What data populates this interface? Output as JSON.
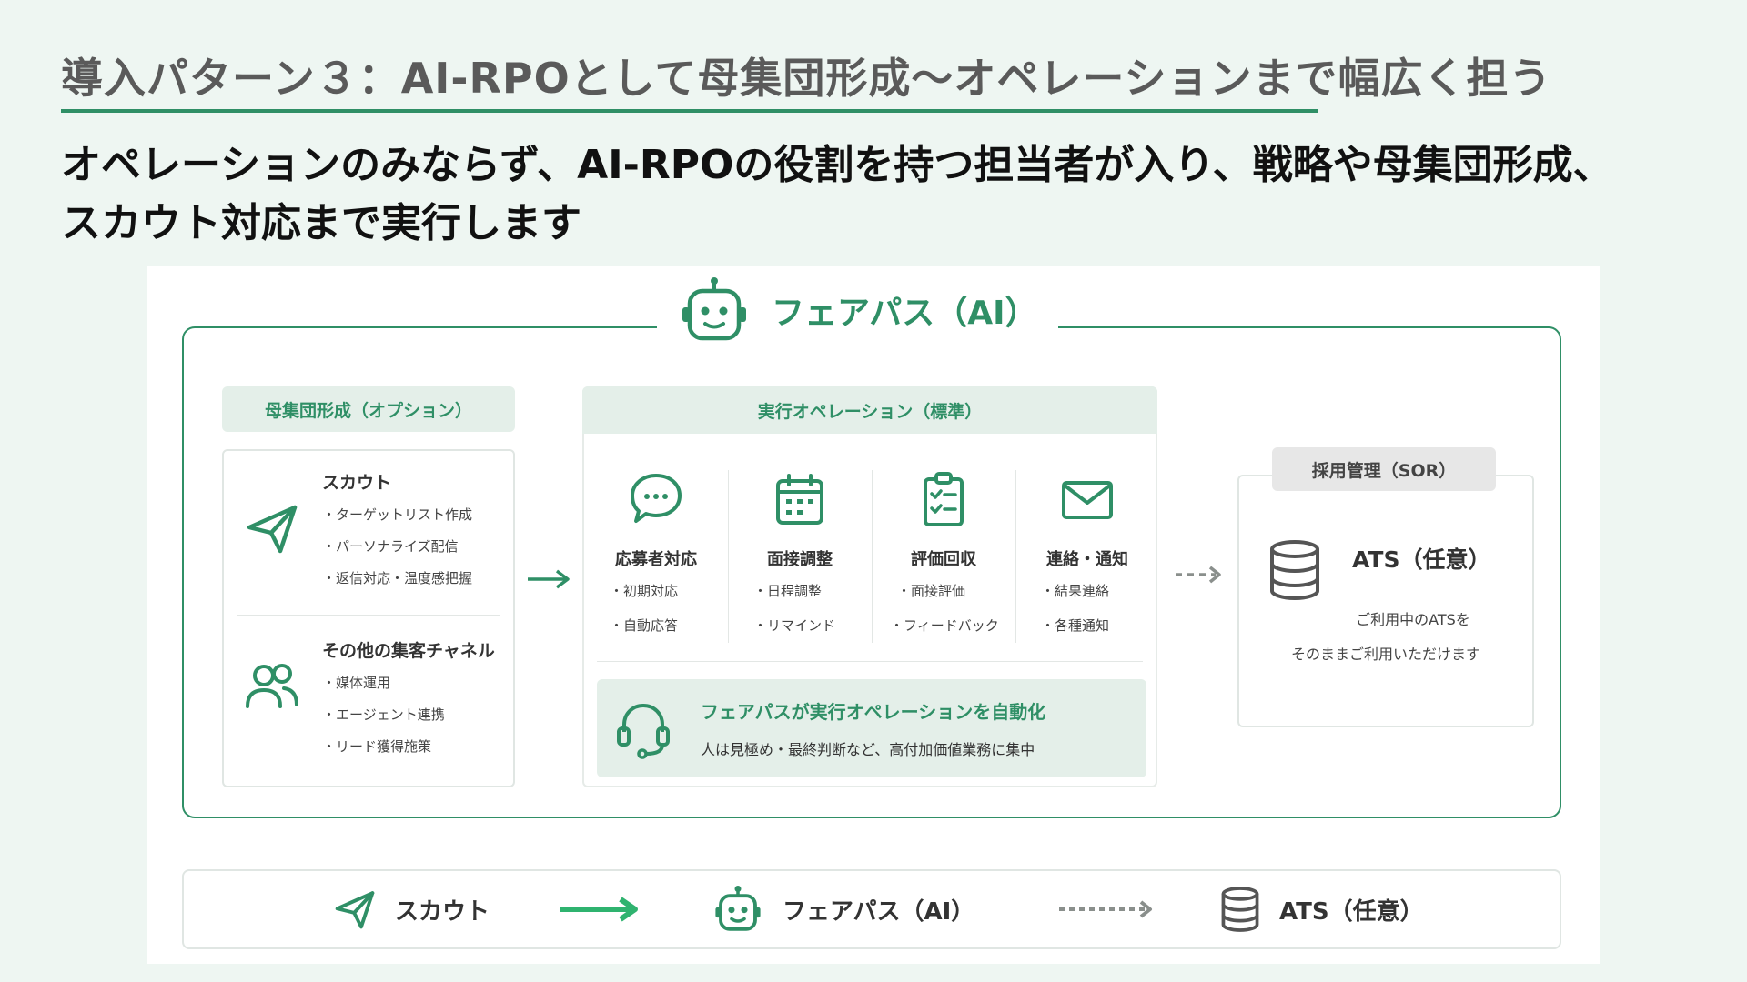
{
  "page": {
    "title": "導入パターン３：AI-RPOとして母集団形成〜オペレーションまで幅広く担う",
    "subtitle": "オペレーションのみならず、AI-RPOの役割を持つ担当者が入り、戦略や母集団形成、スカウト対応まで実行します"
  },
  "colors": {
    "accent": "#2f8f66",
    "background": "#eef6f2",
    "section_bg": "#e4efe9"
  },
  "diagram": {
    "ai_label": "フェアパス（AI）",
    "sourcing": {
      "header": "母集団形成（オプション）",
      "blocks": [
        {
          "icon": "paper-plane-icon",
          "title": "スカウト",
          "bullets": [
            "・ターゲットリスト作成",
            "・パーソナライズ配信",
            "・返信対応・温度感把握"
          ]
        },
        {
          "icon": "users-icon",
          "title": "その他の集客チャネル",
          "bullets": [
            "・媒体運用",
            "・エージェント連携",
            "・リード獲得施策"
          ]
        }
      ]
    },
    "execution": {
      "header": "実行オペレーション（標準）",
      "columns": [
        {
          "icon": "chat-bubble-icon",
          "title": "応募者対応",
          "bullets": [
            "・初期対応",
            "・自動応答"
          ]
        },
        {
          "icon": "calendar-icon",
          "title": "面接調整",
          "bullets": [
            "・日程調整",
            "・リマインド"
          ]
        },
        {
          "icon": "clipboard-check-icon",
          "title": "評価回収",
          "bullets": [
            "・面接評価",
            "・フィードバック"
          ]
        },
        {
          "icon": "mail-icon",
          "title": "連絡・通知",
          "bullets": [
            "・結果連絡",
            "・各種通知"
          ]
        }
      ],
      "automation": {
        "icon": "headset-icon",
        "title": "フェアパスが実行オペレーションを自動化",
        "subtitle": "人は見極め・最終判断など、高付加価値業務に集中"
      }
    },
    "ats": {
      "header": "採用管理（SOR）",
      "icon": "database-icon",
      "title": "ATS（任意）",
      "desc_line1": "ご利用中のATSを",
      "desc_line2": "そのままご利用いただけます"
    },
    "flow": {
      "items": [
        {
          "icon": "paper-plane-icon",
          "label": "スカウト"
        },
        {
          "icon": "robot-icon",
          "label": "フェアパス（AI）"
        },
        {
          "icon": "database-icon",
          "label": "ATS（任意）"
        }
      ]
    }
  }
}
